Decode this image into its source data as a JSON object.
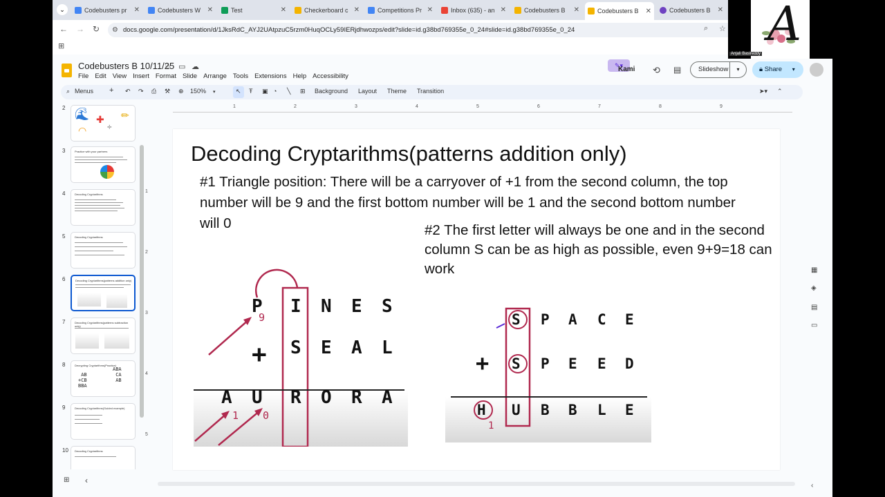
{
  "browser": {
    "tabs": [
      {
        "label": "Codebusters pr",
        "icon": "docs-icon",
        "color": "#4285f4"
      },
      {
        "label": "Codebusters W",
        "icon": "docs-icon",
        "color": "#4285f4"
      },
      {
        "label": "Test",
        "icon": "sheets-icon",
        "color": "#0f9d58"
      },
      {
        "label": "Checkerboard c",
        "icon": "slides-icon",
        "color": "#f4b400"
      },
      {
        "label": "Competitions Pr",
        "icon": "docs-icon",
        "color": "#4285f4"
      },
      {
        "label": "Inbox (635) - an",
        "icon": "gmail-icon",
        "color": "#ea4335"
      },
      {
        "label": "Codebusters B",
        "icon": "slides-icon",
        "color": "#f4b400"
      },
      {
        "label": "Codebusters B",
        "icon": "slides-icon",
        "color": "#f4b400"
      },
      {
        "label": "Codebusters B",
        "icon": "kami-icon",
        "color": "#6f42c1"
      }
    ],
    "url": "docs.google.com/presentation/d/1JksRdC_AYJ2UAtpzuC5rzm0HuqOCLy59IERjdhwozps/edit?slide=id.g38bd769355e_0_24#slide=id.g38bd769355e_0_24"
  },
  "doc": {
    "title": "Codebusters B 10/11/25",
    "menu": [
      "File",
      "Edit",
      "View",
      "Insert",
      "Format",
      "Slide",
      "Arrange",
      "Tools",
      "Extensions",
      "Help",
      "Accessibility"
    ],
    "kami_label": "Kami",
    "slideshow_label": "Slideshow",
    "share_label": "Share"
  },
  "toolbar": {
    "menus_label": "Menus",
    "zoom": "150%",
    "background_label": "Background",
    "layout_label": "Layout",
    "theme_label": "Theme",
    "transition_label": "Transition"
  },
  "ruler": {
    "h": [
      "1",
      "2",
      "3",
      "4",
      "5",
      "6",
      "7",
      "8",
      "9"
    ],
    "v": [
      "1",
      "2",
      "3",
      "4",
      "5"
    ]
  },
  "filmstrip": [
    {
      "num": "2",
      "title": ""
    },
    {
      "num": "3",
      "title": "Practice with your partners"
    },
    {
      "num": "4",
      "title": "Decoding Cryptarithms"
    },
    {
      "num": "5",
      "title": "Decoding Cryptarithms"
    },
    {
      "num": "6",
      "title": "Decoding Cryptarithms(patterns addition only)",
      "selected": true
    },
    {
      "num": "7",
      "title": "Decoding Cryptarithms(patterns subtraction only)"
    },
    {
      "num": "8",
      "title": "Decrypting Cryptarithms(Practice)"
    },
    {
      "num": "9",
      "title": "Decoding Cryptarithms(Guided example)"
    },
    {
      "num": "10",
      "title": "Decoding Cryptarithms"
    }
  ],
  "slide": {
    "title": "Decoding Cryptarithms(patterns addition only)",
    "note1": "#1 Triangle position: There will be a carryover of +1 from the second column, the top number will be 9 and the first bottom number will be 1 and the second bottom number will 0",
    "note2": "#2 The first letter will always be one and in the second column S can be as high as possible, even 9+9=18 can work",
    "puzzle1": {
      "row1": [
        "P",
        "I",
        "N",
        "E",
        "S"
      ],
      "row2": [
        "S",
        "E",
        "A",
        "L"
      ],
      "row3": [
        "A",
        "U",
        "R",
        "O",
        "R",
        "A"
      ],
      "plus": "+",
      "annot_9": "9",
      "annot_1": "1",
      "annot_0": "0"
    },
    "puzzle2": {
      "row1": [
        "S",
        "P",
        "A",
        "C",
        "E"
      ],
      "row2": [
        "S",
        "P",
        "E",
        "E",
        "D"
      ],
      "row3": [
        "H",
        "U",
        "B",
        "B",
        "L",
        "E"
      ],
      "plus": "+",
      "annot_1": "1"
    }
  },
  "webcam": {
    "name": "Anjali Basireddy",
    "logo_letter": "A"
  }
}
